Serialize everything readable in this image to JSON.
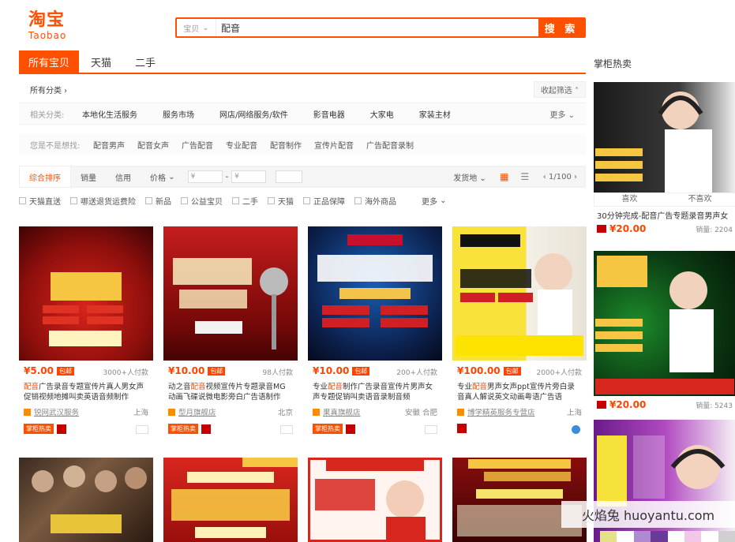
{
  "logo": {
    "cn": "淘宝",
    "en": "Taobao"
  },
  "search": {
    "scope": "宝贝",
    "query": "配音",
    "button": "搜 索"
  },
  "tabs": [
    {
      "label": "所有宝贝"
    },
    {
      "label": "天猫"
    },
    {
      "label": "二手"
    }
  ],
  "filters": {
    "all_categories": "所有分类",
    "fold": "收起筛选",
    "related_label": "相关分类:",
    "related": [
      "本地化生活服务",
      "服务市场",
      "网店/网络服务/软件",
      "影音电器",
      "大家电",
      "家装主材"
    ],
    "more": "更多",
    "guess_label": "您是不是想找:",
    "guess": [
      "配音男声",
      "配音女声",
      "广告配音",
      "专业配音",
      "配音制作",
      "宣传片配音",
      "广告配音录制"
    ]
  },
  "sortbar": {
    "default": "综合排序",
    "sales": "销量",
    "credit": "信用",
    "price": "价格",
    "price_from": "¥",
    "price_to": "¥",
    "ship_from": "发货地",
    "page": "1/100"
  },
  "checks": [
    "天猫直送",
    "哪送退货运费险",
    "新品",
    "公益宝贝",
    "二手",
    "天猫",
    "正品保障",
    "海外商品",
    "更多"
  ],
  "products": [
    {
      "price": "¥5.00",
      "tag": "包邮",
      "sold": "3000+人付款",
      "title_hl": "配音",
      "title": "广告录音专题宣传片真人男女声促销视频地摊叫卖英语音频制作",
      "shop": "锐网武汉服务",
      "loc": "上海",
      "hot": "掌柜热卖"
    },
    {
      "price": "¥10.00",
      "tag": "包邮",
      "sold": "98人付款",
      "title_pre": "动之音",
      "title_hl": "配音",
      "title": "视频宣传片专题录音MG动画飞碟说微电影旁白广告语制作",
      "shop": "型月旗舰店",
      "loc": "北京",
      "hot": "掌柜热卖"
    },
    {
      "price": "¥10.00",
      "tag": "包邮",
      "sold": "200+人付款",
      "title_pre": "专业",
      "title_hl": "配音",
      "title": "制作广告录音宣传片男声女声专题促销叫卖语音录制音频",
      "shop": "果真旗舰店",
      "loc": "安徽 合肥",
      "hot": "掌柜热卖"
    },
    {
      "price": "¥100.00",
      "tag": "包邮",
      "sold": "2000+人付款",
      "title_pre": "专业",
      "title_hl": "配音",
      "title": "男声女声ppt宣传片旁白录音真人解说英文动画粤语广告语",
      "shop": "博学精英服务专营店",
      "loc": "上海",
      "hot": ""
    }
  ],
  "sidebar": {
    "title": "掌柜热卖",
    "items": [
      {
        "like": "喜欢",
        "dislike": "不喜欢",
        "name": "30分钟完成-配音广告专题录音男声女",
        "price": "¥20.00",
        "sold": "销量: 2204"
      },
      {
        "price": "¥20.00",
        "sold": "销量: 5243"
      }
    ]
  },
  "watermark": "火焰兔 huoyantu.com",
  "colors": {
    "accent": "#ff5000",
    "price": "#ff4400",
    "tmall": "#c40000"
  }
}
